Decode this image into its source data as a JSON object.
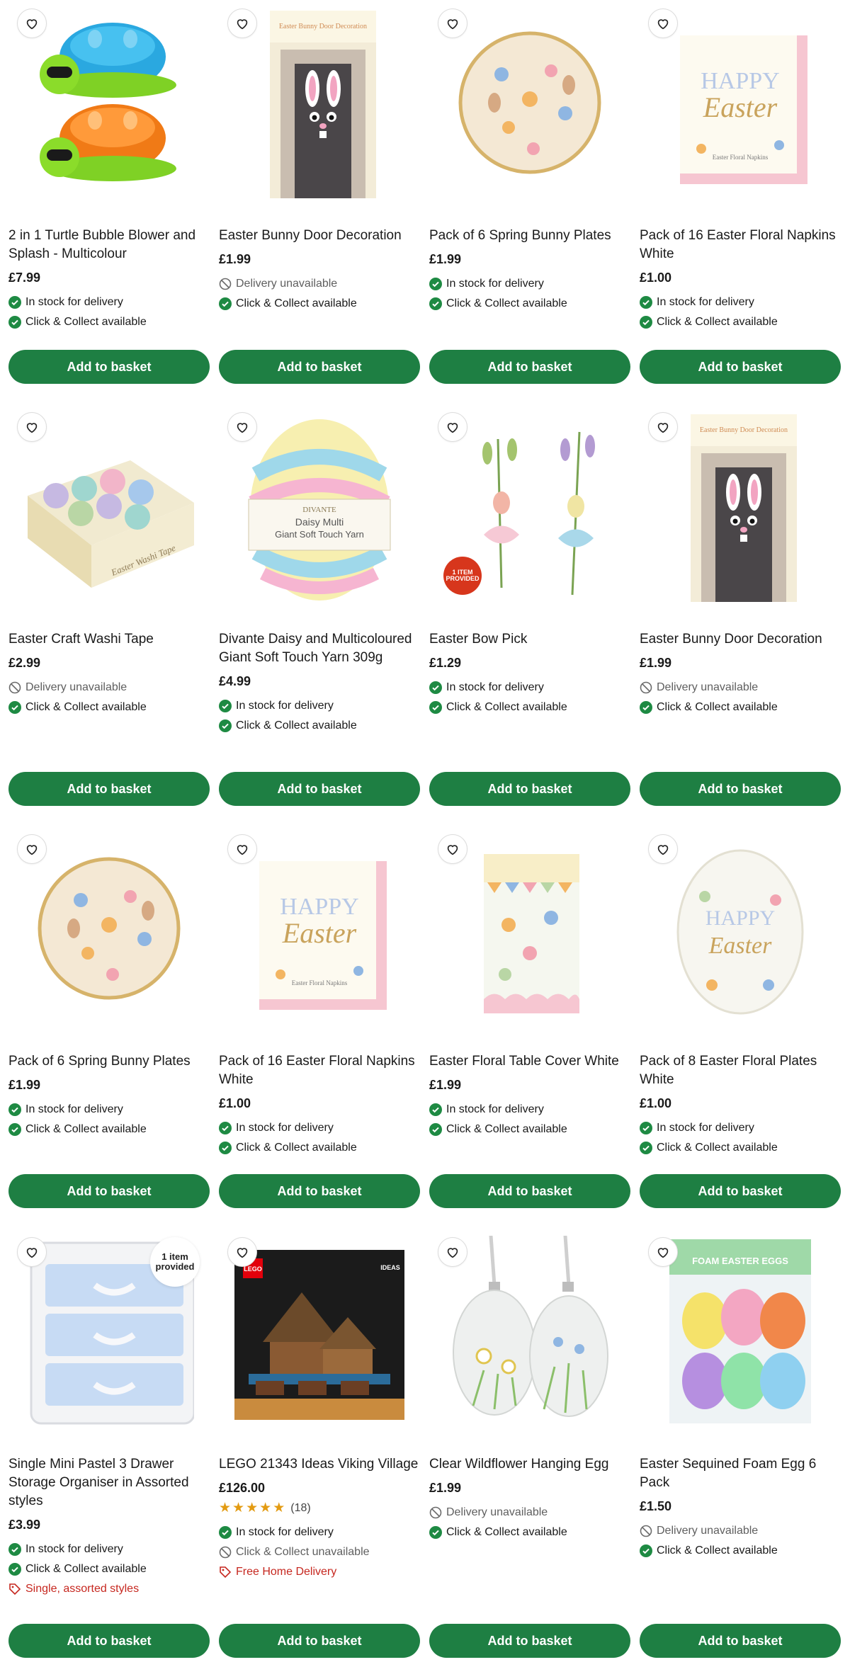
{
  "common": {
    "add_label": "Add to basket"
  },
  "products": [
    {
      "title": "2 in 1 Turtle Bubble Blower and Splash - Multicolour",
      "price": "£7.99",
      "statuses": [
        {
          "type": "check",
          "text": "In stock for delivery"
        },
        {
          "type": "check",
          "text": "Click & Collect available"
        }
      ]
    },
    {
      "title": "Easter Bunny Door Decoration",
      "price": "£1.99",
      "statuses": [
        {
          "type": "unavail",
          "text": "Delivery unavailable"
        },
        {
          "type": "check",
          "text": "Click & Collect available"
        }
      ]
    },
    {
      "title": "Pack of 6 Spring Bunny Plates",
      "price": "£1.99",
      "statuses": [
        {
          "type": "check",
          "text": "In stock for delivery"
        },
        {
          "type": "check",
          "text": "Click & Collect available"
        }
      ]
    },
    {
      "title": "Pack of 16 Easter Floral Napkins White",
      "price": "£1.00",
      "statuses": [
        {
          "type": "check",
          "text": "In stock for delivery"
        },
        {
          "type": "check",
          "text": "Click & Collect available"
        }
      ]
    },
    {
      "title": "Easter Craft Washi Tape",
      "price": "£2.99",
      "statuses": [
        {
          "type": "unavail",
          "text": "Delivery unavailable"
        },
        {
          "type": "check",
          "text": "Click & Collect available"
        }
      ]
    },
    {
      "title": "Divante Daisy and Multicoloured Giant Soft Touch Yarn 309g",
      "price": "£4.99",
      "statuses": [
        {
          "type": "check",
          "text": "In stock for delivery"
        },
        {
          "type": "check",
          "text": "Click & Collect available"
        }
      ]
    },
    {
      "title": "Easter Bow Pick",
      "price": "£1.29",
      "badge": "1 ITEM PROVIDED",
      "statuses": [
        {
          "type": "check",
          "text": "In stock for delivery"
        },
        {
          "type": "check",
          "text": "Click & Collect available"
        }
      ]
    },
    {
      "title": "Easter Bunny Door Decoration",
      "price": "£1.99",
      "statuses": [
        {
          "type": "unavail",
          "text": "Delivery unavailable"
        },
        {
          "type": "check",
          "text": "Click & Collect available"
        }
      ]
    },
    {
      "title": "Pack of 6 Spring Bunny Plates",
      "price": "£1.99",
      "statuses": [
        {
          "type": "check",
          "text": "In stock for delivery"
        },
        {
          "type": "check",
          "text": "Click & Collect available"
        }
      ]
    },
    {
      "title": "Pack of 16 Easter Floral Napkins White",
      "price": "£1.00",
      "statuses": [
        {
          "type": "check",
          "text": "In stock for delivery"
        },
        {
          "type": "check",
          "text": "Click & Collect available"
        }
      ]
    },
    {
      "title": "Easter Floral Table Cover White",
      "price": "£1.99",
      "statuses": [
        {
          "type": "check",
          "text": "In stock for delivery"
        },
        {
          "type": "check",
          "text": "Click & Collect available"
        }
      ]
    },
    {
      "title": "Pack of 8 Easter Floral Plates White",
      "price": "£1.00",
      "statuses": [
        {
          "type": "check",
          "text": "In stock for delivery"
        },
        {
          "type": "check",
          "text": "Click & Collect available"
        }
      ]
    },
    {
      "title": "Single Mini Pastel 3 Drawer Storage Organiser in Assorted styles",
      "price": "£3.99",
      "badge": "1 item provided",
      "statuses": [
        {
          "type": "check",
          "text": "In stock for delivery"
        },
        {
          "type": "check",
          "text": "Click & Collect available"
        },
        {
          "type": "tag",
          "text": "Single, assorted styles"
        }
      ]
    },
    {
      "title": "LEGO 21343 Ideas Viking Village",
      "price": "£126.00",
      "rating": 5,
      "reviews": "(18)",
      "statuses": [
        {
          "type": "check",
          "text": "In stock for delivery"
        },
        {
          "type": "unavail",
          "text": "Click & Collect unavailable"
        },
        {
          "type": "tag",
          "text": "Free Home Delivery"
        }
      ]
    },
    {
      "title": "Clear Wildflower Hanging Egg",
      "price": "£1.99",
      "statuses": [
        {
          "type": "unavail",
          "text": "Delivery unavailable"
        },
        {
          "type": "check",
          "text": "Click & Collect available"
        }
      ]
    },
    {
      "title": "Easter Sequined Foam Egg 6 Pack",
      "price": "£1.50",
      "statuses": [
        {
          "type": "unavail",
          "text": "Delivery unavailable"
        },
        {
          "type": "check",
          "text": "Click & Collect available"
        }
      ]
    }
  ],
  "image_text": {
    "door_banner": "Easter Bunny Door Decoration",
    "napkin_happy": "HAPPY",
    "napkin_easter": "Easter",
    "napkin_sub": "Easter Floral Napkins",
    "yarn_brand": "DIVANTE",
    "yarn_name": "Daisy Multi",
    "yarn_sub": "Giant Soft Touch Yarn",
    "washi_label": "Easter Washi Tape",
    "lego_brand": "LEGO",
    "lego_ideas": "IDEAS",
    "foam_label": "FOAM EASTER EGGS"
  },
  "colors": {
    "button": "#1e7f43",
    "check": "#1e8a43",
    "promo": "#c6271f",
    "star": "#e39b12"
  }
}
